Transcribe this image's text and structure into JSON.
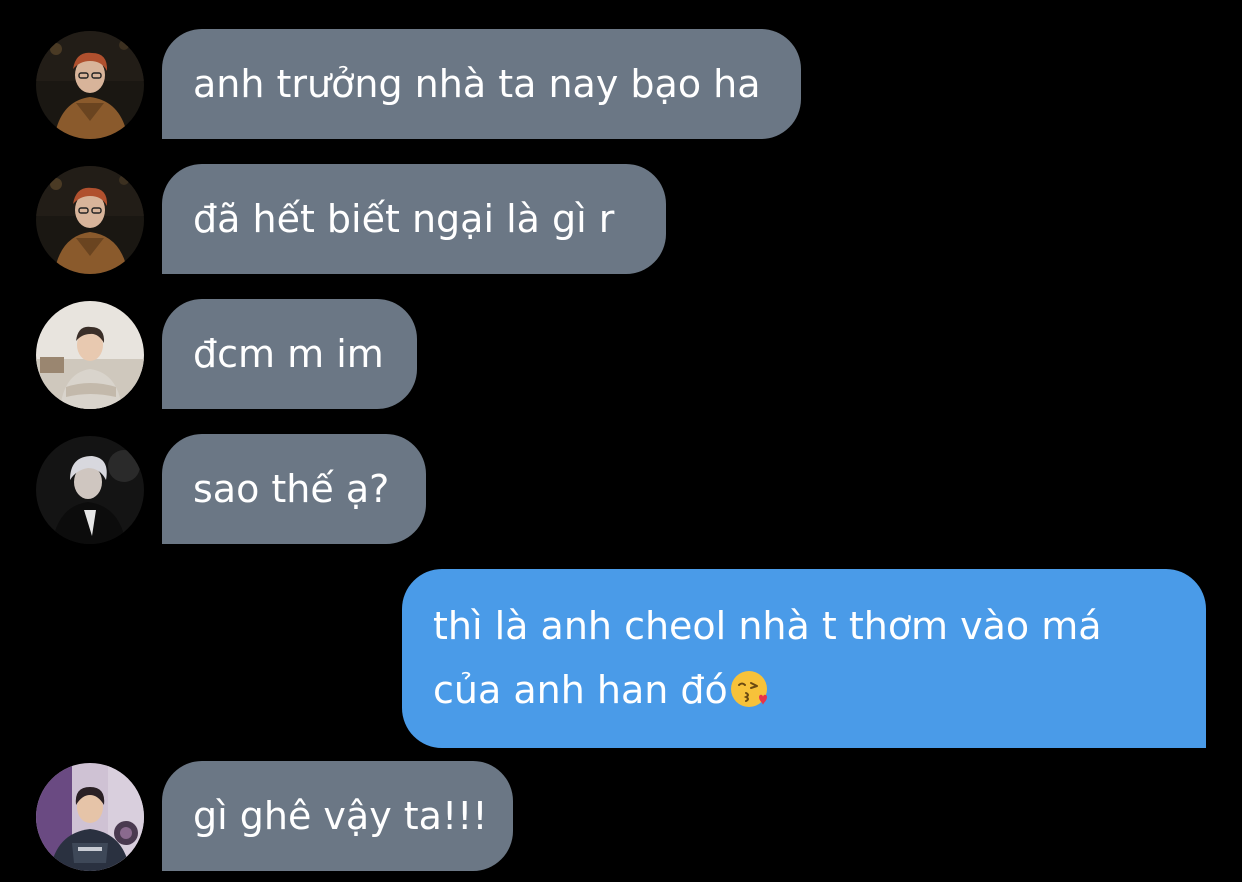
{
  "colors": {
    "background": "#000000",
    "incoming_bubble": "#6b7785",
    "outgoing_bubble": "#4a9be8",
    "text": "#ffffff"
  },
  "messages": [
    {
      "direction": "incoming",
      "avatar": "avatar-1",
      "text": "anh trưởng nhà ta nay bạo ha"
    },
    {
      "direction": "incoming",
      "avatar": "avatar-1",
      "text": "đã hết biết ngại là gì r"
    },
    {
      "direction": "incoming",
      "avatar": "avatar-2",
      "text": "đcm m im"
    },
    {
      "direction": "incoming",
      "avatar": "avatar-3",
      "text": "sao thế ạ?"
    },
    {
      "direction": "outgoing",
      "text": "thì là anh cheol nhà t thơm vào má của anh han đó",
      "emoji": "kissing-face-with-heart-icon"
    },
    {
      "direction": "incoming",
      "avatar": "avatar-4",
      "text": "gì ghê vậy ta!!!"
    }
  ]
}
